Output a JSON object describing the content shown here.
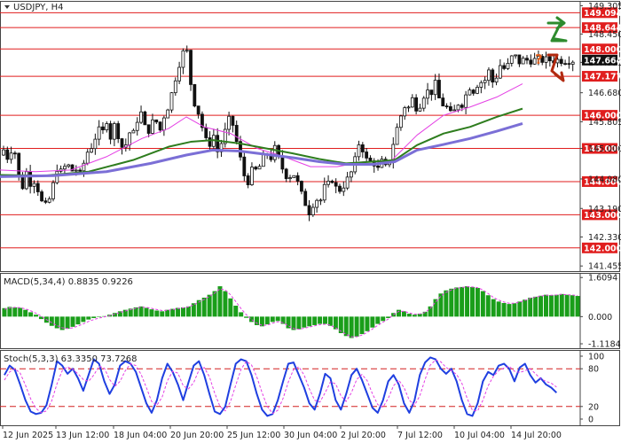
{
  "chart_data": [
    {
      "type": "candlestick",
      "title": "USDJPY, H4",
      "x_ticks": [
        "12 Jun 2025",
        "13 Jun 12:00",
        "18 Jun 04:00",
        "20 Jun 20:00",
        "25 Jun 12:00",
        "30 Jun 04:00",
        "2 Jul 20:00",
        "7 Jul 12:00",
        "10 Jul 04:00",
        "14 Jul 20:00"
      ],
      "y_ticks": [
        149.305,
        148.45,
        147.595,
        146.68,
        145.805,
        145.0,
        144.08,
        143.19,
        142.33,
        141.455
      ],
      "ylim": [
        141.3,
        149.45
      ],
      "levels": [
        {
          "value": 149.094,
          "label": "149.094",
          "color": "#e01e1e"
        },
        {
          "value": 148.644,
          "label": "148.644",
          "color": "#e01e1e"
        },
        {
          "value": 148.0,
          "label": "148.000",
          "color": "#e01e1e"
        },
        {
          "value": 147.177,
          "label": "147.177",
          "color": "#e01e1e"
        },
        {
          "value": 146.0,
          "label": "146.000",
          "color": "#e01e1e"
        },
        {
          "value": 145.0,
          "label": "145.000",
          "color": "#e01e1e"
        },
        {
          "value": 144.0,
          "label": "144.000",
          "color": "#e01e1e"
        },
        {
          "value": 143.0,
          "label": "143.000",
          "color": "#e01e1e"
        },
        {
          "value": 142.0,
          "label": "142.000",
          "color": "#e01e1e"
        }
      ],
      "last_price": {
        "value": 147.664,
        "label": "147.664"
      },
      "close_path": [
        [
          0,
          144.8
        ],
        [
          5,
          145.0
        ],
        [
          10,
          144.6
        ],
        [
          15,
          145.3
        ],
        [
          20,
          144.2
        ],
        [
          25,
          143.8
        ],
        [
          30,
          144.3
        ],
        [
          35,
          143.9
        ],
        [
          40,
          144.1
        ],
        [
          45,
          143.5
        ],
        [
          50,
          143.2
        ],
        [
          55,
          143.4
        ],
        [
          60,
          143.9
        ],
        [
          65,
          144.5
        ],
        [
          70,
          144.2
        ],
        [
          75,
          144.6
        ],
        [
          80,
          144.3
        ],
        [
          85,
          144.4
        ],
        [
          90,
          144.2
        ],
        [
          95,
          144.6
        ],
        [
          100,
          145.0
        ],
        [
          105,
          145.1
        ],
        [
          110,
          145.6
        ],
        [
          115,
          145.4
        ],
        [
          120,
          145.9
        ],
        [
          125,
          145.3
        ],
        [
          130,
          145.8
        ],
        [
          135,
          145.2
        ],
        [
          140,
          144.9
        ],
        [
          145,
          145.5
        ],
        [
          150,
          145.4
        ],
        [
          155,
          145.9
        ],
        [
          160,
          146.1
        ],
        [
          165,
          145.4
        ],
        [
          170,
          145.7
        ],
        [
          175,
          145.9
        ],
        [
          180,
          145.5
        ],
        [
          185,
          146.0
        ],
        [
          190,
          146.3
        ],
        [
          195,
          146.8
        ],
        [
          200,
          147.4
        ],
        [
          205,
          147.8
        ],
        [
          210,
          148.1
        ],
        [
          213,
          147.3
        ],
        [
          216,
          146.8
        ],
        [
          220,
          146.3
        ],
        [
          225,
          146.0
        ],
        [
          230,
          145.4
        ],
        [
          235,
          145.0
        ],
        [
          240,
          145.5
        ],
        [
          245,
          144.9
        ],
        [
          250,
          145.2
        ],
        [
          255,
          145.6
        ],
        [
          260,
          146.0
        ],
        [
          265,
          145.4
        ],
        [
          270,
          144.8
        ],
        [
          275,
          144.2
        ],
        [
          280,
          144.0
        ],
        [
          285,
          144.4
        ],
        [
          290,
          144.3
        ],
        [
          295,
          144.6
        ],
        [
          300,
          144.9
        ],
        [
          305,
          144.7
        ],
        [
          310,
          145.0
        ],
        [
          315,
          144.6
        ],
        [
          320,
          144.3
        ],
        [
          325,
          144.1
        ],
        [
          330,
          144.3
        ],
        [
          335,
          144.0
        ],
        [
          340,
          143.6
        ],
        [
          345,
          143.3
        ],
        [
          350,
          143.0
        ],
        [
          355,
          143.6
        ],
        [
          360,
          143.3
        ],
        [
          365,
          143.8
        ],
        [
          370,
          143.9
        ],
        [
          375,
          144.1
        ],
        [
          380,
          143.7
        ],
        [
          385,
          143.8
        ],
        [
          390,
          144.0
        ],
        [
          395,
          144.2
        ],
        [
          400,
          144.6
        ],
        [
          403,
          145.1
        ],
        [
          406,
          145.2
        ],
        [
          410,
          144.9
        ],
        [
          415,
          144.5
        ],
        [
          420,
          144.7
        ],
        [
          425,
          144.3
        ],
        [
          430,
          144.6
        ],
        [
          435,
          144.4
        ],
        [
          440,
          144.7
        ],
        [
          445,
          145.4
        ],
        [
          450,
          145.8
        ],
        [
          455,
          146.3
        ],
        [
          460,
          146.2
        ],
        [
          465,
          146.5
        ],
        [
          470,
          146.2
        ],
        [
          475,
          146.4
        ],
        [
          480,
          146.8
        ],
        [
          485,
          146.6
        ],
        [
          490,
          147.0
        ],
        [
          495,
          146.5
        ],
        [
          500,
          146.3
        ],
        [
          505,
          146.2
        ],
        [
          510,
          145.9
        ],
        [
          515,
          146.4
        ],
        [
          520,
          146.3
        ],
        [
          525,
          146.6
        ],
        [
          530,
          146.9
        ],
        [
          535,
          146.7
        ],
        [
          540,
          147.1
        ],
        [
          545,
          146.9
        ],
        [
          550,
          147.4
        ],
        [
          555,
          147.0
        ],
        [
          560,
          147.2
        ],
        [
          565,
          147.6
        ],
        [
          570,
          147.3
        ],
        [
          575,
          147.7
        ],
        [
          580,
          147.8
        ],
        [
          585,
          147.6
        ],
        [
          589,
          147.664
        ]
      ],
      "moving_averages": [
        {
          "name": "MA fast",
          "color": "#e43fe4",
          "points": [
            [
              0,
              144.35
            ],
            [
              40,
              144.3
            ],
            [
              80,
              144.35
            ],
            [
              120,
              144.75
            ],
            [
              160,
              145.3
            ],
            [
              190,
              145.6
            ],
            [
              210,
              145.95
            ],
            [
              230,
              145.65
            ],
            [
              260,
              145.45
            ],
            [
              290,
              145.0
            ],
            [
              320,
              144.75
            ],
            [
              350,
              144.45
            ],
            [
              380,
              144.45
            ],
            [
              410,
              144.6
            ],
            [
              440,
              144.6
            ],
            [
              470,
              145.4
            ],
            [
              500,
              146.0
            ],
            [
              530,
              146.25
            ],
            [
              560,
              146.55
            ],
            [
              589,
              146.95
            ]
          ]
        },
        {
          "name": "MA mid",
          "color": "#2e7d1e",
          "points": [
            [
              0,
              144.2
            ],
            [
              50,
              144.18
            ],
            [
              100,
              144.3
            ],
            [
              150,
              144.65
            ],
            [
              190,
              145.05
            ],
            [
              215,
              145.2
            ],
            [
              240,
              145.25
            ],
            [
              270,
              145.15
            ],
            [
              300,
              145.0
            ],
            [
              330,
              144.85
            ],
            [
              360,
              144.68
            ],
            [
              390,
              144.55
            ],
            [
              420,
              144.6
            ],
            [
              445,
              144.65
            ],
            [
              470,
              145.1
            ],
            [
              500,
              145.45
            ],
            [
              530,
              145.65
            ],
            [
              560,
              145.95
            ],
            [
              589,
              146.2
            ]
          ]
        },
        {
          "name": "MA slow",
          "color": "#7b6fd6",
          "points": [
            [
              0,
              144.15
            ],
            [
              60,
              144.18
            ],
            [
              120,
              144.3
            ],
            [
              170,
              144.55
            ],
            [
              210,
              144.8
            ],
            [
              240,
              144.95
            ],
            [
              270,
              144.92
            ],
            [
              300,
              144.82
            ],
            [
              330,
              144.72
            ],
            [
              360,
              144.6
            ],
            [
              390,
              144.52
            ],
            [
              420,
              144.52
            ],
            [
              445,
              144.6
            ],
            [
              470,
              144.95
            ],
            [
              500,
              145.12
            ],
            [
              530,
              145.3
            ],
            [
              560,
              145.52
            ],
            [
              589,
              145.75
            ]
          ]
        }
      ]
    },
    {
      "type": "histogram",
      "title": "MACD(5,34,4) 0.8835 0.9226",
      "y_ticks": [
        1.6094,
        0.0,
        -1.1184
      ],
      "ylim": [
        -1.3,
        1.8
      ],
      "color": "#1a9e1a",
      "signal_color": "#e43fe4",
      "values": [
        0.35,
        0.4,
        0.38,
        0.36,
        0.28,
        0.18,
        0.08,
        -0.1,
        -0.25,
        -0.38,
        -0.48,
        -0.55,
        -0.5,
        -0.42,
        -0.32,
        -0.22,
        -0.12,
        -0.06,
        -0.02,
        0.02,
        0.08,
        0.15,
        0.22,
        0.28,
        0.33,
        0.38,
        0.42,
        0.36,
        0.3,
        0.25,
        0.22,
        0.28,
        0.32,
        0.36,
        0.38,
        0.42,
        0.55,
        0.68,
        0.78,
        0.9,
        1.05,
        1.25,
        1.05,
        0.75,
        0.45,
        0.18,
        -0.05,
        -0.22,
        -0.35,
        -0.4,
        -0.32,
        -0.22,
        -0.18,
        -0.3,
        -0.48,
        -0.55,
        -0.52,
        -0.45,
        -0.4,
        -0.35,
        -0.3,
        -0.3,
        -0.38,
        -0.52,
        -0.68,
        -0.8,
        -0.88,
        -0.82,
        -0.72,
        -0.6,
        -0.45,
        -0.3,
        -0.18,
        -0.06,
        0.15,
        0.28,
        0.22,
        0.12,
        0.08,
        0.12,
        0.2,
        0.42,
        0.72,
        0.95,
        1.08,
        1.15,
        1.2,
        1.22,
        1.25,
        1.22,
        1.18,
        1.05,
        0.88,
        0.72,
        0.62,
        0.56,
        0.52,
        0.55,
        0.62,
        0.7,
        0.78,
        0.82,
        0.86,
        0.9,
        0.88,
        0.9,
        0.93,
        0.9,
        0.88,
        0.85
      ],
      "signal": [
        0.3,
        0.36,
        0.38,
        0.37,
        0.32,
        0.24,
        0.14,
        0.02,
        -0.12,
        -0.25,
        -0.37,
        -0.46,
        -0.49,
        -0.46,
        -0.39,
        -0.3,
        -0.2,
        -0.12,
        -0.06,
        -0.01,
        0.04,
        0.1,
        0.17,
        0.23,
        0.29,
        0.34,
        0.39,
        0.38,
        0.34,
        0.29,
        0.25,
        0.26,
        0.29,
        0.33,
        0.36,
        0.4,
        0.48,
        0.6,
        0.71,
        0.83,
        0.97,
        1.14,
        1.1,
        0.9,
        0.62,
        0.33,
        0.08,
        -0.12,
        -0.27,
        -0.36,
        -0.35,
        -0.27,
        -0.21,
        -0.25,
        -0.38,
        -0.49,
        -0.52,
        -0.48,
        -0.43,
        -0.38,
        -0.33,
        -0.31,
        -0.35,
        -0.46,
        -0.6,
        -0.73,
        -0.83,
        -0.83,
        -0.76,
        -0.65,
        -0.51,
        -0.36,
        -0.23,
        -0.1,
        0.08,
        0.22,
        0.22,
        0.15,
        0.1,
        0.11,
        0.17,
        0.34,
        0.6,
        0.84,
        1.0,
        1.1,
        1.17,
        1.2,
        1.23,
        1.22,
        1.19,
        1.1,
        0.95,
        0.79,
        0.68,
        0.6,
        0.55,
        0.55,
        0.6,
        0.67,
        0.75,
        0.8,
        0.84,
        0.88,
        0.88,
        0.89,
        0.92,
        0.9,
        0.89,
        0.87
      ]
    },
    {
      "type": "line",
      "title": "Stoch(5,3,3) 63.3350 73.7268",
      "y_ticks": [
        100,
        80,
        20,
        0
      ],
      "ylim": [
        0,
        100
      ],
      "levels": [
        80,
        20
      ],
      "series": [
        {
          "name": "%K",
          "color": "#1f3fe0",
          "values": [
            70,
            85,
            78,
            55,
            30,
            12,
            8,
            10,
            22,
            55,
            92,
            85,
            72,
            80,
            65,
            45,
            70,
            95,
            88,
            60,
            40,
            55,
            85,
            92,
            88,
            75,
            50,
            25,
            10,
            30,
            65,
            88,
            75,
            55,
            30,
            58,
            85,
            92,
            70,
            40,
            12,
            8,
            20,
            55,
            88,
            95,
            92,
            70,
            40,
            15,
            5,
            8,
            30,
            60,
            88,
            90,
            70,
            50,
            25,
            15,
            40,
            72,
            65,
            30,
            15,
            40,
            70,
            80,
            62,
            40,
            18,
            10,
            30,
            60,
            70,
            55,
            25,
            10,
            30,
            70,
            90,
            98,
            95,
            80,
            72,
            80,
            60,
            30,
            8,
            5,
            25,
            60,
            75,
            70,
            85,
            88,
            80,
            60,
            82,
            88,
            70,
            58,
            65,
            55,
            50,
            42
          ]
        },
        {
          "name": "%D",
          "color": "#e43fe4",
          "dashed": true,
          "values": [
            62,
            75,
            80,
            73,
            54,
            32,
            17,
            10,
            13,
            29,
            56,
            77,
            83,
            79,
            72,
            63,
            60,
            70,
            84,
            81,
            63,
            52,
            60,
            77,
            88,
            85,
            71,
            50,
            28,
            22,
            35,
            61,
            76,
            73,
            53,
            48,
            58,
            78,
            82,
            67,
            41,
            20,
            13,
            28,
            54,
            79,
            92,
            86,
            67,
            42,
            20,
            9,
            14,
            33,
            59,
            79,
            83,
            70,
            48,
            30,
            27,
            42,
            59,
            56,
            37,
            28,
            42,
            63,
            71,
            61,
            40,
            23,
            19,
            33,
            53,
            62,
            50,
            30,
            22,
            37,
            63,
            86,
            94,
            91,
            82,
            77,
            71,
            57,
            33,
            14,
            13,
            30,
            53,
            68,
            77,
            81,
            84,
            76,
            74,
            77,
            80,
            72,
            64,
            60,
            57,
            51
          ]
        }
      ]
    }
  ]
}
